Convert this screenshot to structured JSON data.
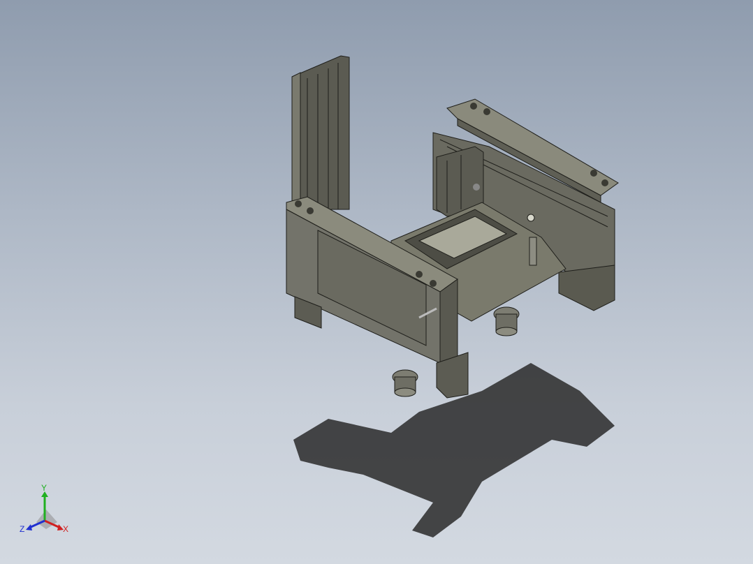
{
  "viewport": {
    "background_top": "#8f9cae",
    "background_bottom": "#d3d9e1"
  },
  "model": {
    "body_color": "#6f6f64",
    "edge_color": "#1e1e1a",
    "shadow_color": "#2a2a2a"
  },
  "triad": {
    "x_label": "X",
    "y_label": "Y",
    "z_label": "Z",
    "x_color": "#d02020",
    "y_color": "#20b020",
    "z_color": "#2030d0"
  }
}
